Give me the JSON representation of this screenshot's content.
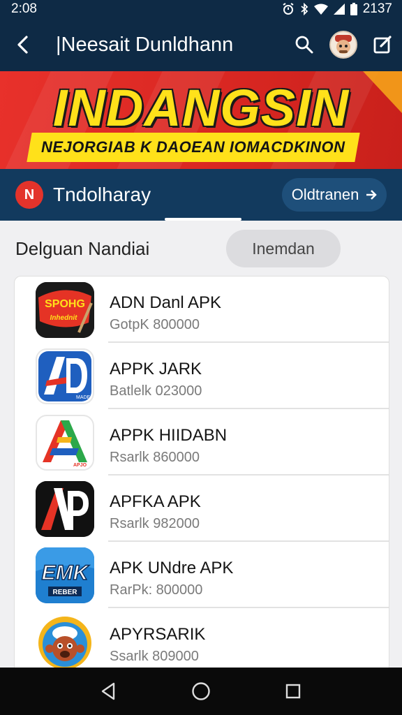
{
  "status_bar": {
    "time": "2:08",
    "clock_right": "2137"
  },
  "app_bar": {
    "title": "|Neesait Dunldhann"
  },
  "banner": {
    "title": "INDANGSIN",
    "subtitle": "NEJORGIAB K DAOEAN IOMACDKINON"
  },
  "channel": {
    "name": "Tndolharay",
    "logo_letter": "N",
    "button_label": "Oldtranen"
  },
  "section": {
    "title": "Delguan Nandiai",
    "chip_label": "Inemdan"
  },
  "apps": [
    {
      "name": "ADN Danl APK",
      "meta": "GotpK 800000",
      "icon": "spohg-app-icon",
      "icon_text": "SPOHG"
    },
    {
      "name": "APPK JARK",
      "meta": "Batlelk 023000",
      "icon": "ap-blue-app-icon",
      "icon_text": "AD"
    },
    {
      "name": "APPK HIIDABN",
      "meta": "Rsarlk 860000",
      "icon": "a-green-app-icon",
      "icon_text": "A"
    },
    {
      "name": "APFKA APK",
      "meta": "Rsarlk 982000",
      "icon": "ap-black-app-icon",
      "icon_text": "AP"
    },
    {
      "name": "APK UNdre APK",
      "meta": "RarPk: 800000",
      "icon": "emk-app-icon",
      "icon_text": "EMK"
    },
    {
      "name": "APYRSARIK",
      "meta": "Ssarlk 809000",
      "icon": "mascot-app-icon",
      "icon_text": ""
    }
  ],
  "colors": {
    "header": "#0e2a45",
    "channel_bar": "#123a5e",
    "banner_red": "#e3312b",
    "banner_yellow": "#ffe11a"
  }
}
